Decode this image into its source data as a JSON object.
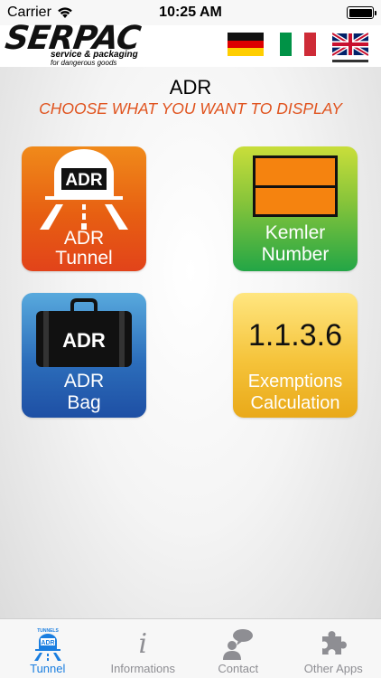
{
  "status_bar": {
    "carrier": "Carrier",
    "time": "10:25 AM"
  },
  "header": {
    "logo_text": "SERPAC",
    "logo_tagline": "service & packaging",
    "logo_tagline2": "for dangerous goods",
    "languages": [
      "German",
      "Italian",
      "English"
    ],
    "selected_language": "English"
  },
  "page": {
    "title": "ADR",
    "subtitle": "CHOOSE WHAT YOU WANT TO DISPLAY"
  },
  "tiles": [
    {
      "icon_text": "ADR",
      "label_line1": "ADR",
      "label_line2": "Tunnel",
      "color": "#e75f12"
    },
    {
      "label_line1": "Kemler",
      "label_line2": "Number",
      "color": "#23a646"
    },
    {
      "icon_text": "ADR",
      "label_line1": "ADR",
      "label_line2": "Bag",
      "color": "#2c6ebb"
    },
    {
      "number": "1.1.3.6",
      "label_line1": "Exemptions",
      "label_line2": "Calculation",
      "color": "#f5c33a"
    }
  ],
  "tabs": [
    {
      "label": "Tunnel",
      "icon": "tunnel-icon",
      "icon_small_text": "TUNNELS",
      "icon_text": "ADR",
      "active": true
    },
    {
      "label": "Informations",
      "icon": "info-icon",
      "icon_glyph": "i",
      "active": false
    },
    {
      "label": "Contact",
      "icon": "contact-icon",
      "active": false
    },
    {
      "label": "Other Apps",
      "icon": "puzzle-icon",
      "active": false
    }
  ],
  "colors": {
    "accent": "#1a7ee0",
    "subtitle": "#e0531e"
  }
}
